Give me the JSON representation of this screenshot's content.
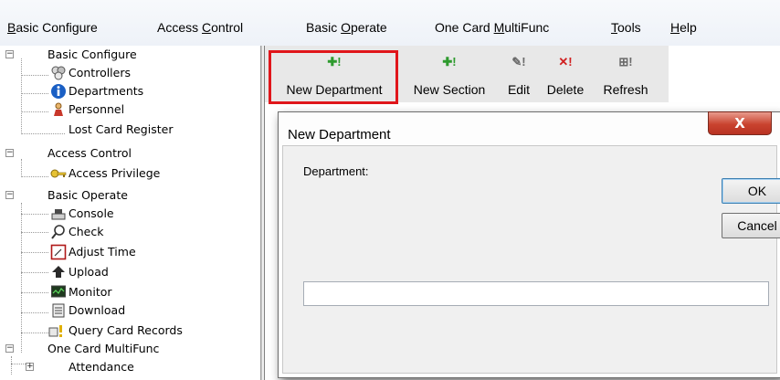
{
  "menu": {
    "items": [
      {
        "label": "Basic Configure",
        "mnemonic": "B"
      },
      {
        "label": "Access Control",
        "mnemonic": "C"
      },
      {
        "label": "Basic Operate",
        "mnemonic": "O"
      },
      {
        "label": "One Card MultiFunc",
        "mnemonic": "M"
      },
      {
        "label": "Tools",
        "mnemonic": "T"
      },
      {
        "label": "Help",
        "mnemonic": "H"
      }
    ]
  },
  "tree": {
    "nodes": [
      {
        "label": "Basic Configure",
        "expander": "⊟"
      },
      {
        "label": "Controllers",
        "icon": "controllers-icon"
      },
      {
        "label": "Departments",
        "icon": "info-icon"
      },
      {
        "label": "Personnel",
        "icon": "person-icon"
      },
      {
        "label": "Lost Card Register"
      },
      {
        "label": "Access Control",
        "expander": "⊟"
      },
      {
        "label": "Access Privilege",
        "icon": "key-icon"
      },
      {
        "label": "Basic Operate",
        "expander": "⊟"
      },
      {
        "label": "Console",
        "icon": "console-icon"
      },
      {
        "label": "Check",
        "icon": "check-icon"
      },
      {
        "label": "Adjust Time",
        "icon": "clock-icon"
      },
      {
        "label": "Upload",
        "icon": "upload-icon"
      },
      {
        "label": "Monitor",
        "icon": "monitor-icon"
      },
      {
        "label": "Download",
        "icon": "download-icon"
      },
      {
        "label": "Query Card Records",
        "icon": "query-icon"
      },
      {
        "label": "One Card MultiFunc",
        "expander": "⊟"
      },
      {
        "label": "Attendance",
        "expander": "⊞"
      }
    ]
  },
  "toolbar": {
    "buttons": [
      {
        "label": "New Department",
        "icon": "✚!",
        "icon_color": "#2e9a2e",
        "highlighted": true
      },
      {
        "label": "New Section",
        "icon": "✚!",
        "icon_color": "#2e9a2e"
      },
      {
        "label": "Edit",
        "icon": "✎!",
        "icon_color": "#6a6a6a"
      },
      {
        "label": "Delete",
        "icon": "✕!",
        "icon_color": "#d02020"
      },
      {
        "label": "Refresh",
        "icon": "⊞!",
        "icon_color": "#6a6a6a"
      }
    ]
  },
  "dialog": {
    "title": "New Department",
    "close_label": "X",
    "field_label": "Department:",
    "field_value": "",
    "ok_label": "OK",
    "cancel_label": "Cancel"
  },
  "colors": {
    "highlight": "#e0161b",
    "close_button": "#c9432f"
  }
}
